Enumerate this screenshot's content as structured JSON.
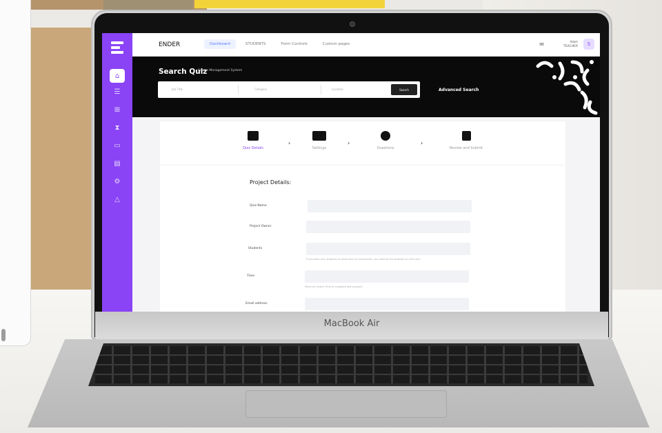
{
  "device": {
    "brand": "MacBook Air"
  },
  "app": {
    "name": "ENDER",
    "nav": [
      {
        "label": "Dashboard",
        "active": true
      },
      {
        "label": "STUDENTS",
        "active": false
      },
      {
        "label": "Form Controls",
        "active": false
      },
      {
        "label": "Custom pages",
        "active": false
      }
    ],
    "user": {
      "role": "Adam",
      "name": "TEACHER",
      "avatar_letter": "S"
    },
    "sidebar_icons": [
      "home-icon",
      "list-icon",
      "plus-square-icon",
      "hourglass-icon",
      "chat-icon",
      "document-icon",
      "settings-icon",
      "warning-icon"
    ],
    "colors": {
      "accent": "#8a43f5",
      "hero_bg": "#0a0a0a"
    }
  },
  "hero": {
    "title": "Search Quiz",
    "subtitle": "Exams Management System",
    "search": {
      "fields": [
        "Job Title",
        "Category",
        "Location"
      ],
      "button": "Search"
    },
    "advanced_search": "Advanced Search"
  },
  "wizard": {
    "steps": [
      {
        "label": "Quiz Details",
        "icon": "monitor-icon",
        "active": true
      },
      {
        "label": "Settings",
        "icon": "desktop-icon",
        "active": false
      },
      {
        "label": "Questions",
        "icon": "globe-icon",
        "active": false
      },
      {
        "label": "Review and Submit",
        "icon": "file-icon",
        "active": false
      }
    ],
    "section_title": "Project Details:",
    "fields": [
      {
        "label": "Quiz Name",
        "hint": ""
      },
      {
        "label": "Project Owner",
        "hint": ""
      },
      {
        "label": "Students",
        "hint": "If you want your students to select quiz for submission, you need to the question on click here"
      },
      {
        "label": "Time",
        "hint": "Minimum Select Time to complete test answers"
      },
      {
        "label": "Email address",
        "hint": ""
      }
    ]
  }
}
